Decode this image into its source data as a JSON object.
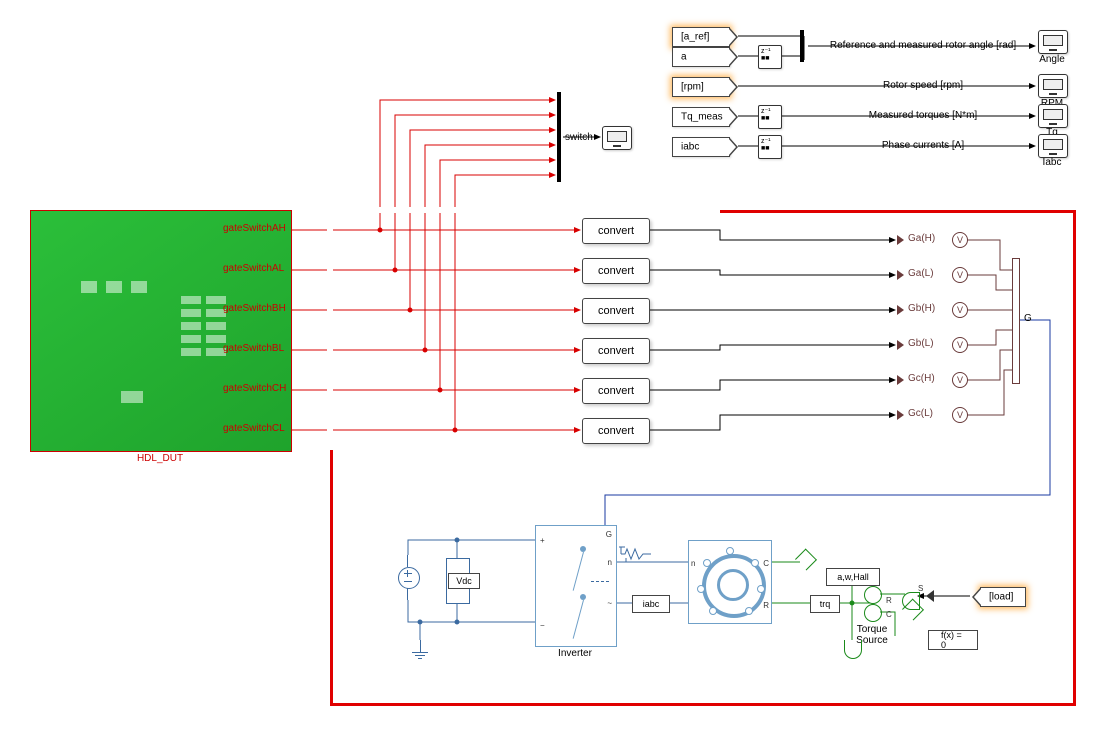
{
  "hdl_dut": {
    "label": "HDL_DUT",
    "outputs": [
      "gateSwitchAH",
      "gateSwitchAL",
      "gateSwitchBH",
      "gateSwitchBL",
      "gateSwitchCH",
      "gateSwitchCL"
    ]
  },
  "convert_blocks": {
    "label": "convert",
    "count": 6
  },
  "switch_label": "switch",
  "gate_labels": [
    "Ga(H)",
    "Ga(L)",
    "Gb(H)",
    "Gb(L)",
    "Gc(H)",
    "Gc(L)"
  ],
  "mux_out_label": "G",
  "scopes": {
    "top": {
      "signals": [
        {
          "tag": "[a_ref]",
          "desc": "Reference and measured rotor angle [rad]",
          "display": "Angle",
          "glow": true
        },
        {
          "tag": "a",
          "desc": "",
          "display": "",
          "glow": false
        },
        {
          "tag": "[rpm]",
          "desc": "Rotor speed [rpm]",
          "display": "RPM",
          "glow": true
        },
        {
          "tag": "Tq_meas",
          "desc": "Measured torques [N*m]",
          "display": "Tq",
          "glow": false
        },
        {
          "tag": "iabc",
          "desc": "Phase currents [A]",
          "display": "Iabc",
          "glow": false
        }
      ]
    }
  },
  "plant": {
    "vdc_label": "Vdc",
    "inverter_label": "Inverter",
    "iabc_label": "iabc",
    "motor_ports": {
      "n": "n",
      "C": "C",
      "R": "R"
    },
    "awh_label": "a,w,Hall",
    "trq_label": "trq",
    "torque_source_label": "Torque\nSource",
    "solver_label": "f(x) = 0",
    "load_tag": "[load]",
    "sensor_ports": {
      "S": "S",
      "R": "R",
      "C": "C"
    }
  }
}
